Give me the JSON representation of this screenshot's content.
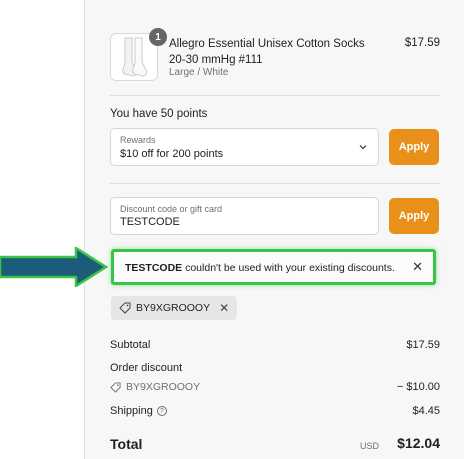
{
  "cart": {
    "item": {
      "name": "Allegro Essential Unisex Cotton Socks 20-30 mmHg #111",
      "variant": "Large / White",
      "price": "$17.59",
      "quantity": "1",
      "thumbnail_icon": "socks-image"
    }
  },
  "rewards": {
    "points_text": "You have 50 points",
    "select_label": "Rewards",
    "select_value": "$10 off for 200 points",
    "apply_label": "Apply"
  },
  "discount": {
    "field_placeholder": "Discount code or gift card",
    "field_value": "TESTCODE",
    "apply_label": "Apply",
    "error": {
      "code": "TESTCODE",
      "message": " couldn't be used with your existing discounts.",
      "close_label": "✕"
    },
    "applied_chip": {
      "code": "BY9XGROOOY",
      "remove_label": "✕"
    }
  },
  "summary": {
    "subtotal_label": "Subtotal",
    "subtotal_value": "$17.59",
    "order_discount_label": "Order discount",
    "order_discount_code": "BY9XGROOOY",
    "order_discount_value": "− $10.00",
    "shipping_label": "Shipping",
    "shipping_value": "$4.45",
    "total_label": "Total",
    "total_currency": "USD",
    "total_value": "$12.04"
  },
  "colors": {
    "accent": "#e8901a",
    "highlight": "#37c447",
    "arrow": "#1c5b7a"
  }
}
